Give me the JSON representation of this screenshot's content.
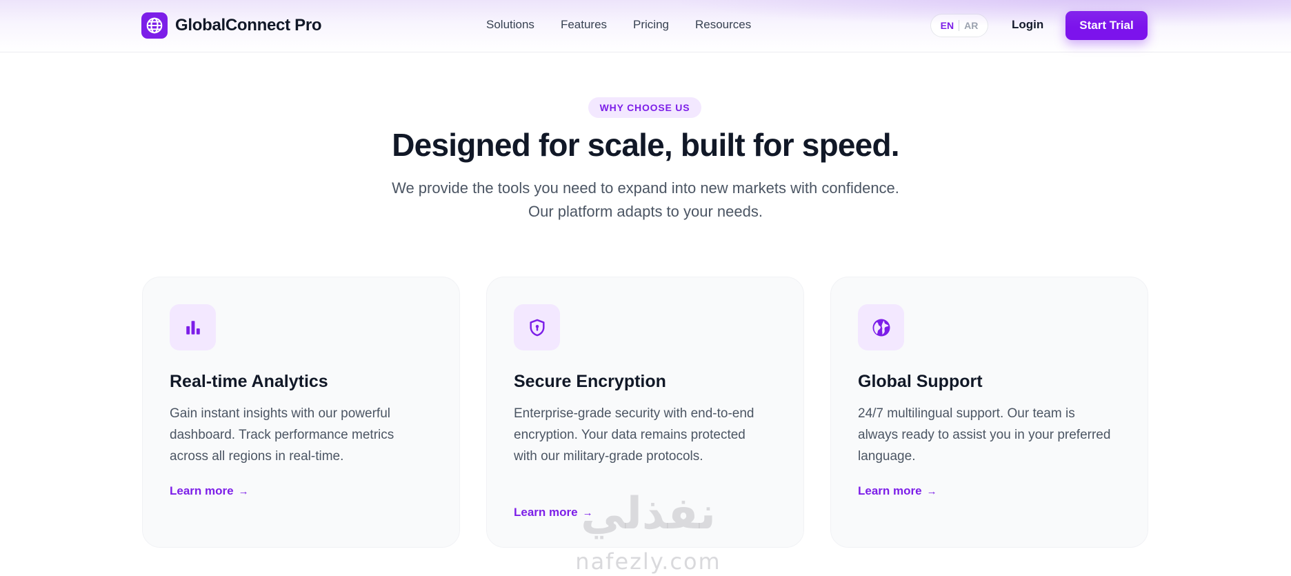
{
  "header": {
    "brand": "GlobalConnect Pro",
    "nav": [
      "Solutions",
      "Features",
      "Pricing",
      "Resources"
    ],
    "lang": {
      "active": "EN",
      "other": "AR"
    },
    "login": "Login",
    "cta": "Start Trial"
  },
  "hero": {
    "eyebrow": "WHY CHOOSE US",
    "title": "Designed for scale, built for speed.",
    "subtitle_line1": "We provide the tools you need to expand into new markets with confidence.",
    "subtitle_line2": "Our platform adapts to your needs."
  },
  "cards": [
    {
      "icon": "bar-chart-icon",
      "title": "Real-time Analytics",
      "description": "Gain instant insights with our powerful dashboard. Track performance metrics across all regions in real-time.",
      "link": "Learn more"
    },
    {
      "icon": "shield-lock-icon",
      "title": "Secure Encryption",
      "description": "Enterprise-grade security with end-to-end encryption. Your data remains protected with our military-grade protocols.",
      "link": "Learn more"
    },
    {
      "icon": "globe-icon",
      "title": "Global Support",
      "description": "24/7 multilingual support. Our team is always ready to assist you in your preferred language.",
      "link": "Learn more"
    }
  ],
  "watermark": {
    "arabic": "نفذلي",
    "latin": "nafezly.com"
  },
  "colors": {
    "accent": "#7c1ee8",
    "accent_soft": "#f3e8ff",
    "text": "#111827",
    "muted": "#4b5563"
  }
}
